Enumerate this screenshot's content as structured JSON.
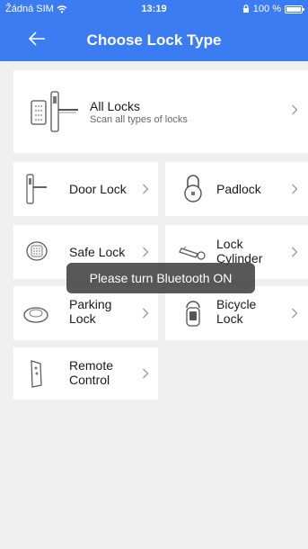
{
  "status": {
    "carrier": "Žádná SIM",
    "time": "13:19",
    "battery": "100 %"
  },
  "header": {
    "title": "Choose Lock Type"
  },
  "all_locks": {
    "title": "All Locks",
    "subtitle": "Scan all types of locks"
  },
  "items": [
    {
      "label": "Door Lock",
      "icon": "door-lock-icon"
    },
    {
      "label": "Padlock",
      "icon": "padlock-icon"
    },
    {
      "label": "Safe Lock",
      "icon": "safe-lock-icon"
    },
    {
      "label": "Lock Cylinder",
      "icon": "lock-cylinder-icon"
    },
    {
      "label": "Parking Lock",
      "icon": "parking-lock-icon"
    },
    {
      "label": "Bicycle Lock",
      "icon": "bicycle-lock-icon"
    },
    {
      "label": "Remote Control",
      "icon": "remote-control-icon"
    }
  ],
  "toast": {
    "message": "Please turn Bluetooth ON"
  },
  "colors": {
    "accent": "#3b7cf2",
    "background": "#f0f0f0",
    "card": "#ffffff",
    "toast": "#4a4a4a"
  }
}
